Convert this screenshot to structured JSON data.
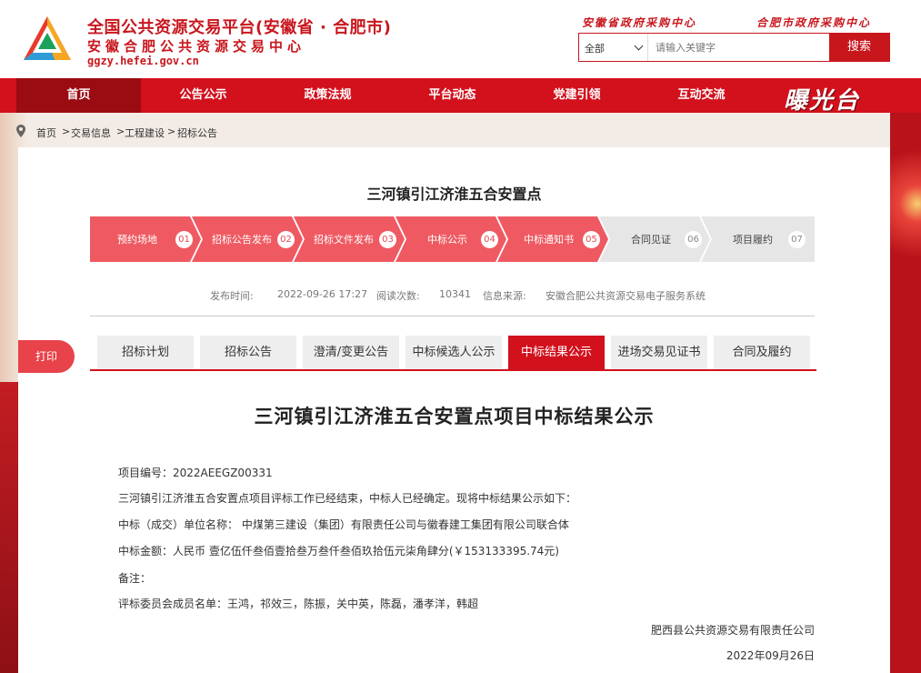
{
  "header": {
    "title": "全国公共资源交易平台(安徽省 · 合肥市)",
    "subtitle": "安徽合肥公共资源交易中心",
    "url": "ggzy.hefei.gov.cn",
    "top_links": [
      "安徽省政府采购中心",
      "合肥市政府采购中心"
    ],
    "search": {
      "category": "全部",
      "placeholder": "请输入关键字",
      "button": "搜索"
    },
    "logo_icon": "triangle-logo-icon"
  },
  "nav": {
    "items": [
      "首页",
      "公告公示",
      "政策法规",
      "平台动态",
      "党建引领",
      "互动交流"
    ],
    "active": 0,
    "brand_text": "曝光台"
  },
  "breadcrumb": {
    "items": [
      "首页",
      "交易信息",
      "工程建设",
      "招标公告"
    ],
    "separator": ">"
  },
  "project": {
    "title": "三河镇引江济淮五合安置点"
  },
  "steps": [
    {
      "label": "预约场地",
      "num": "01",
      "status": "done"
    },
    {
      "label": "招标公告发布",
      "num": "02",
      "status": "done"
    },
    {
      "label": "招标文件发布",
      "num": "03",
      "status": "done"
    },
    {
      "label": "中标公示",
      "num": "04",
      "status": "done"
    },
    {
      "label": "中标通知书",
      "num": "05",
      "status": "done"
    },
    {
      "label": "合同见证",
      "num": "06",
      "status": "todo"
    },
    {
      "label": "项目履约",
      "num": "07",
      "status": "todo"
    }
  ],
  "meta": {
    "publish_label": "发布时间:",
    "publish_time": "2022-09-26 17:27",
    "views_label": "阅读次数:",
    "views": "10341",
    "source_label": "信息来源:",
    "source": "安徽合肥公共资源交易电子服务系统"
  },
  "print_label": "打印",
  "tabs": [
    "招标计划",
    "招标公告",
    "澄清/变更公告",
    "中标候选人公示",
    "中标结果公示",
    "进场交易见证书",
    "合同及履约"
  ],
  "active_tab": 4,
  "article": {
    "title": "三河镇引江济淮五合安置点项目中标结果公示",
    "paragraphs": [
      "项目编号：2022AEEGZ00331",
      "三河镇引江济淮五合安置点项目评标工作已经结束，中标人已经确定。现将中标结果公示如下：",
      "中标（成交）单位名称：  中煤第三建设（集团）有限责任公司与徽春建工集团有限公司联合体",
      "中标金额：人民币 壹亿伍仟叁佰壹拾叁万叁仟叁佰玖拾伍元柒角肆分(￥153133395.74元)",
      "备注：",
      "评标委员会成员名单：王鸿，祁效三，陈振，关中英，陈磊，潘孝洋，韩超"
    ],
    "signature": "肥西县公共资源交易有限责任公司",
    "date": "2022年09月26日"
  },
  "colors": {
    "brand_red": "#d2111d",
    "step_done": "#ef5a62",
    "step_todo": "#e6e6e6"
  }
}
